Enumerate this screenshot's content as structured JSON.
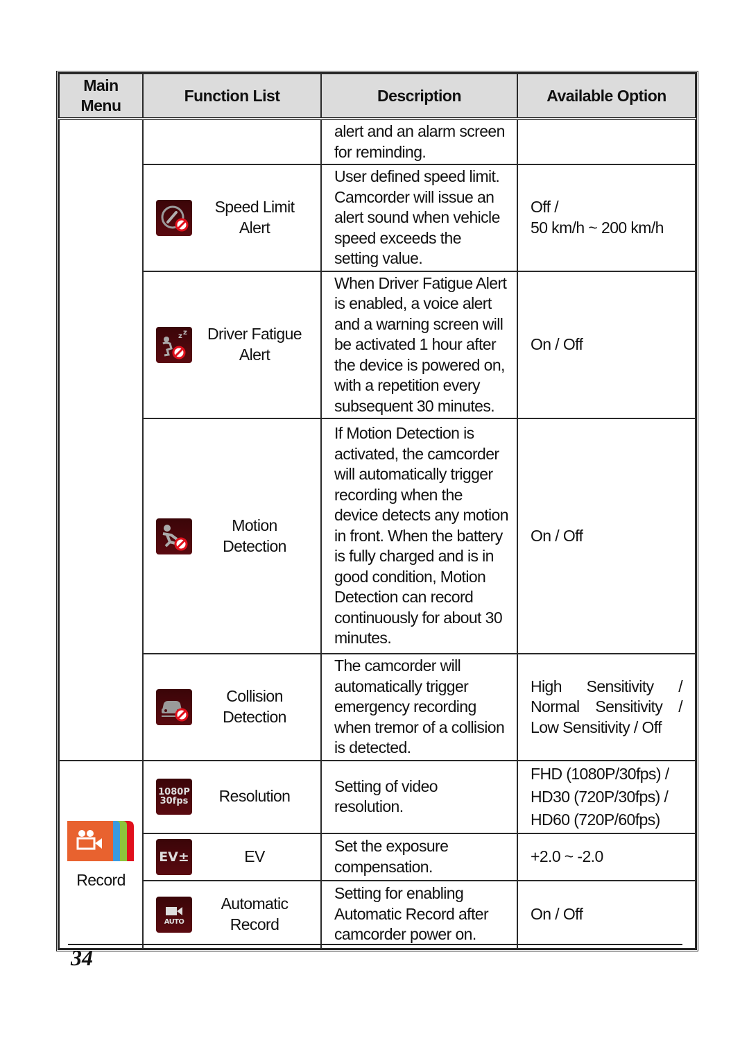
{
  "table": {
    "headers": {
      "main_menu": "Main Menu",
      "function_list": "Function List",
      "description": "Description",
      "available_option": "Available Option"
    },
    "rows": [
      {
        "function": "",
        "icon": "",
        "description": "alert and an alarm screen for reminding.",
        "option": ""
      },
      {
        "function": "Speed Limit Alert",
        "icon": "speed-limit-alert-icon",
        "description": "User defined speed limit. Camcorder will issue an alert sound when vehicle speed exceeds the setting value.",
        "option_lines": [
          "Off /",
          "50 km/h ~ 200 km/h"
        ]
      },
      {
        "function": "Driver Fatigue Alert",
        "icon": "driver-fatigue-alert-icon",
        "description": "When Driver Fatigue Alert is enabled, a voice alert and a warning screen will be activated 1 hour after the device is powered on, with a repetition every subsequent 30 minutes.",
        "option": "On / Off"
      },
      {
        "function": "Motion Detection",
        "icon": "motion-detection-icon",
        "description": "If Motion Detection is activated, the camcorder will automatically trigger recording when the device detects any motion in front. When the battery is fully charged and is in good condition, Motion Detection can record continuously for about 30 minutes.",
        "option": "On / Off"
      },
      {
        "function": "Collision Detection",
        "icon": "collision-detection-icon",
        "description": "The camcorder will automatically trigger emergency recording when tremor of a collision is detected.",
        "option_lines": [
          [
            "High",
            "Sensitivity",
            "/"
          ],
          [
            "Normal",
            "Sensitivity",
            "/"
          ],
          [
            "Low Sensitivity / Off"
          ]
        ]
      },
      {
        "main_menu": "Record",
        "function": "Resolution",
        "icon": "resolution-icon",
        "icon_text": [
          "1080P",
          "30fps"
        ],
        "description": "Setting of video resolution.",
        "option_lines": [
          "FHD (1080P/30fps) /",
          "HD30 (720P/30fps) /",
          "HD60 (720P/60fps)"
        ]
      },
      {
        "function": "EV",
        "icon": "ev-icon",
        "icon_text": [
          "EV±"
        ],
        "description": "Set the exposure compensation.",
        "option": "+2.0 ~ -2.0"
      },
      {
        "function": "Automatic Record",
        "icon": "automatic-record-icon",
        "icon_text": [
          "AUTO"
        ],
        "description": "Setting for enabling Automatic Record after camcorder power on.",
        "option": "On / Off"
      }
    ]
  },
  "colors": {
    "header_bg": "#dcdcdc",
    "icon_bg": "#4a0a0e",
    "prohibit_red": "#e0101c",
    "record_orange": "#e8622f",
    "record_blue": "#3a9be0",
    "record_green": "#8cc43c",
    "record_red": "#e0101c"
  },
  "footer": {
    "page_number": "34"
  }
}
